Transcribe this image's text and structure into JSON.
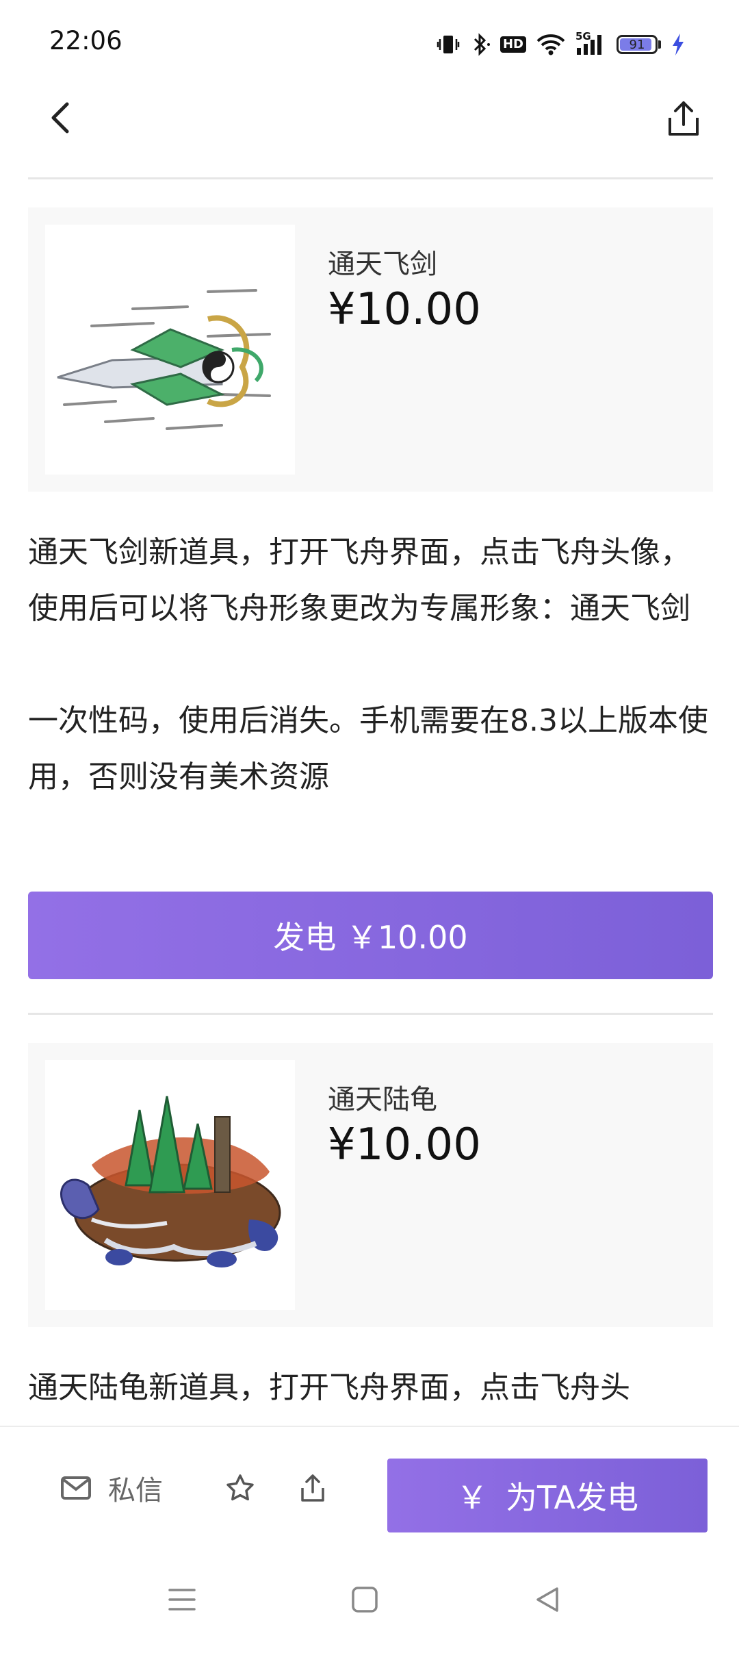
{
  "status_bar": {
    "time": "22:06",
    "hd_label": "HD",
    "network_label": "5G",
    "battery_level": "91",
    "battery_color": "#7b7ce8"
  },
  "products": [
    {
      "name": "通天飞剑",
      "price": "¥10.00",
      "description": "通天飞剑新道具，打开飞舟界面，点击飞舟头像，使用后可以将飞舟形象更改为专属形象：通天飞剑\n\n一次性码，使用后消失。手机需要在8.3以上版本使用，否则没有美术资源",
      "button_label": "发电 ￥10.00"
    },
    {
      "name": "通天陆龟",
      "price": "¥10.00",
      "description": "通天陆龟新道具，打开飞舟界面，点击飞舟头"
    }
  ],
  "bottom_bar": {
    "message_label": "私信",
    "charge_label": "为TA发电",
    "charge_icon": "￥"
  },
  "colors": {
    "accent": "#8a68e0",
    "card_bg": "#f8f8f8",
    "divider": "#e6e6e6"
  }
}
